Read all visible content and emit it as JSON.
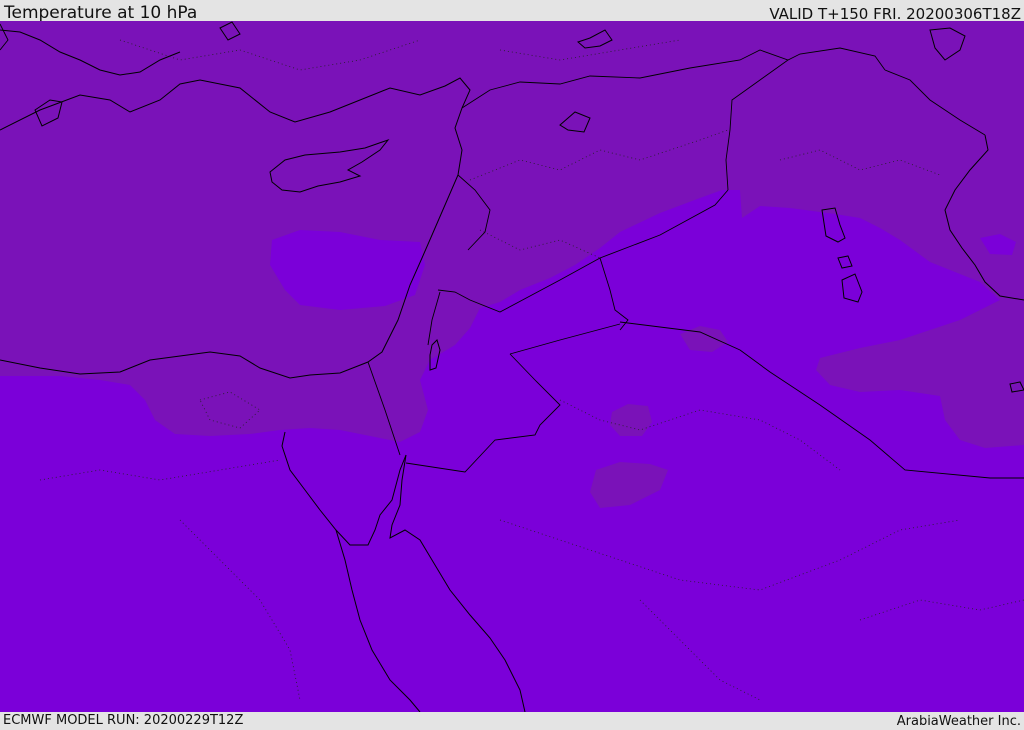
{
  "header": {
    "title": "Temperature at 10 hPa",
    "valid": "VALID T+150 FRI. 20200306T18Z"
  },
  "footer": {
    "model_run": "ECMWF MODEL RUN: 20200229T12Z",
    "credit": "ArabiaWeather Inc."
  },
  "map": {
    "background_color": "#7b00d9",
    "shade_color": "#7a12b8",
    "coastline_color": "#000000"
  }
}
